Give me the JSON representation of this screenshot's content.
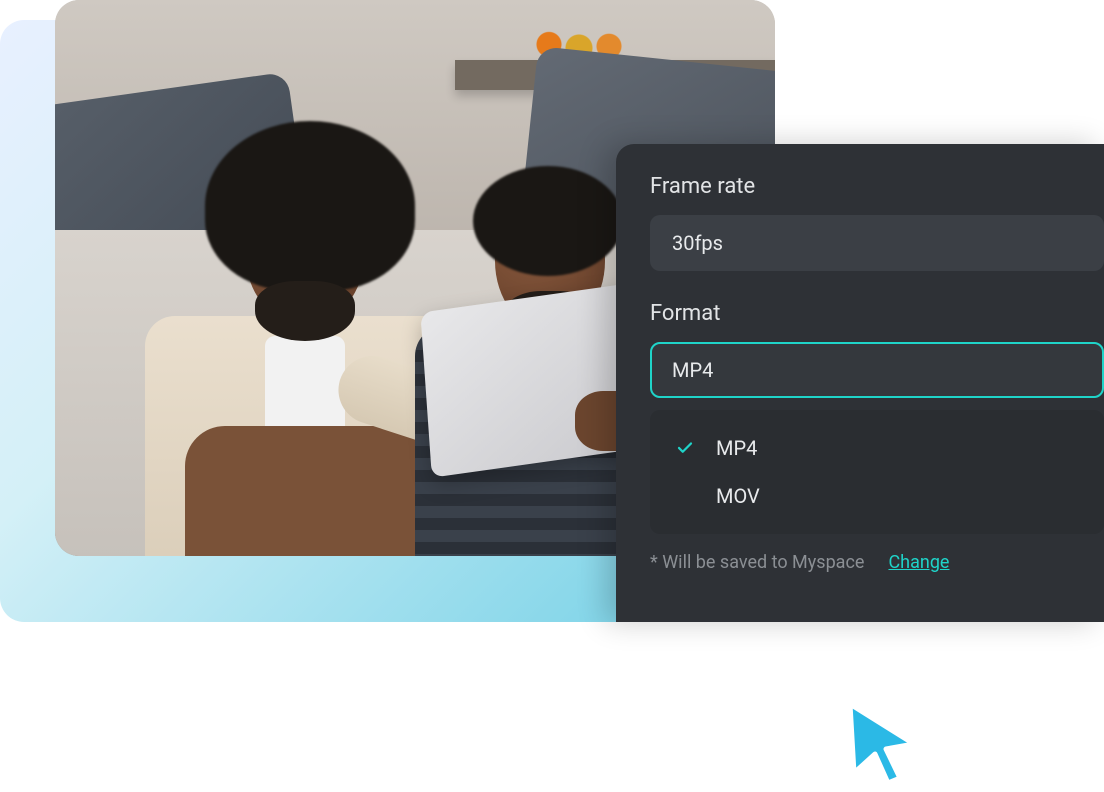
{
  "panel": {
    "frame_rate": {
      "label": "Frame rate",
      "value": "30fps"
    },
    "format": {
      "label": "Format",
      "value": "MP4",
      "options": [
        "MP4",
        "MOV"
      ],
      "selected": "MP4"
    },
    "footer": {
      "note": "* Will be saved to Myspace",
      "change": "Change"
    }
  },
  "colors": {
    "accent": "#1fd4c9",
    "panel_bg": "#2e3136"
  }
}
